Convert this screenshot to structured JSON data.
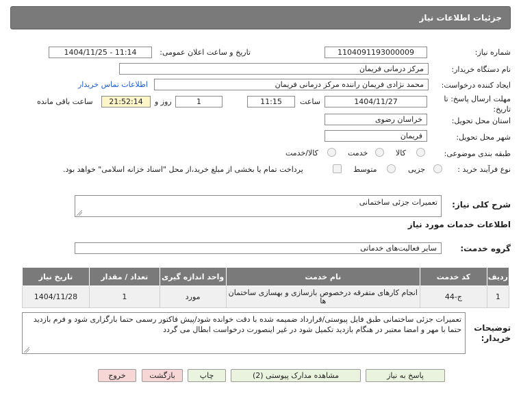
{
  "title": "جزئیات اطلاعات نیاز",
  "fields": {
    "need_number_label": "شماره نیاز:",
    "need_number": "1104091193000009",
    "announce_label": "تاریخ و ساعت اعلان عمومی:",
    "announce_value": "1404/11/25 - 11:14",
    "buyer_org_label": "نام دستگاه خریدار:",
    "buyer_org": "مرکز درمانی فریمان",
    "creator_label": "ایجاد کننده درخواست:",
    "creator": "محمد نژادی فریمان راننده مرکز درمانی فریمان",
    "contact_link": "اطلاعات تماس خریدار",
    "deadline_label": "مهلت ارسال پاسخ: تا تاریخ:",
    "deadline_date": "1404/11/27",
    "time_label": "ساعت",
    "deadline_time": "11:15",
    "days_value": "1",
    "days_label": "روز و",
    "remaining_time": "21:52:14",
    "remaining_label": "ساعت باقی مانده",
    "province_label": "استان محل تحویل:",
    "province": "خراسان رضوی",
    "city_label": "شهر محل تحویل:",
    "city": "فریمان",
    "category_label": "طبقه بندی موضوعی:",
    "category_options": [
      "کالا",
      "خدمت",
      "کالا/خدمت"
    ],
    "process_label": "نوع فرآیند خرید :",
    "process_options": [
      "جزیی",
      "متوسط"
    ],
    "payment_note": "پرداخت تمام یا بخشی از مبلغ خرید،از محل \"اسناد خزانه اسلامی\" خواهد بود."
  },
  "summary": {
    "label": "شرح کلی نیاز:",
    "value": "تعمیرات جزئی ساختمانی"
  },
  "services": {
    "section_title": "اطلاعات خدمات مورد نیاز",
    "group_label": "گروه خدمت:",
    "group_value": "سایر فعالیت‌های خدماتی",
    "columns": [
      "ردیف",
      "کد خدمت",
      "نام خدمت",
      "واحد اندازه گیری",
      "تعداد / مقدار",
      "تاریخ نیاز"
    ],
    "rows": [
      {
        "row": "1",
        "code": "ج-44",
        "name": "انجام کارهای متفرقه درخصوص بازسازی و بهسازی ساختمان ها",
        "unit": "مورد",
        "qty": "1",
        "date": "1404/11/28"
      }
    ]
  },
  "notes": {
    "label": "توضیحات خریدار:",
    "text": "تعمیرات جزئی ساختمانی  طبق فایل پیوستی/قرارداد ضمیمه شده با دقت خوانده شود/پیش فاکتور رسمی حتما بارگزاری شود و فرم بازدید حتما با مهر و امضا معتبر در هنگام بازدید تکمیل شود در غیر اینصورت درخواست ابطال می گردد"
  },
  "buttons": {
    "reply": "پاسخ به نیاز",
    "attachments": "مشاهده مدارک پیوستی (2)",
    "print": "چاپ",
    "back": "بازگشت",
    "exit": "خروج"
  },
  "colors": {
    "header": "#7a7a7a",
    "highlight": "#fbf5c8",
    "link": "#1a5fd6"
  }
}
